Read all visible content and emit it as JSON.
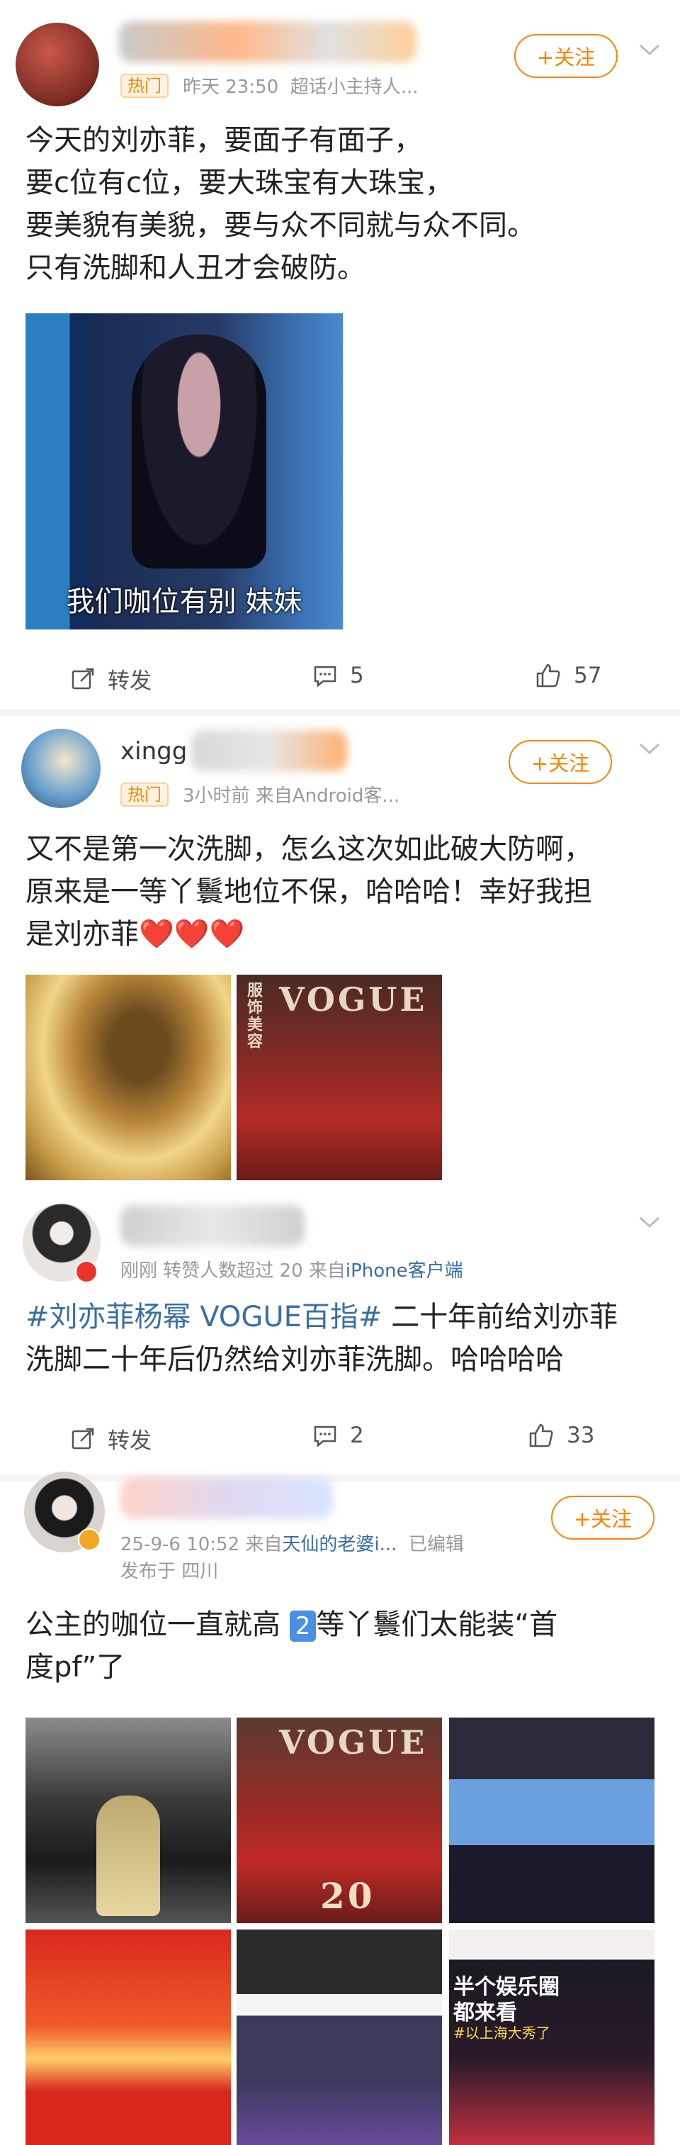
{
  "post1": {
    "hot_badge": "热门",
    "time": "昨天 23:50",
    "source": "超话小主持人...",
    "follow": "+关注",
    "lines": [
      "今天的刘亦菲，要面子有面子，",
      "要c位有c位，要大珠宝有大珠宝，",
      "要美貌有美貌，要与众不同就与众不同。",
      "只有洗脚和人丑才会破防。"
    ],
    "image_caption": "我们咖位有别 妹妹",
    "repost_label": "转发",
    "comments": "5",
    "likes": "57"
  },
  "post2": {
    "username": "xingg",
    "hot_badge": "热门",
    "meta": "3小时前  来自Android客...",
    "follow": "+关注",
    "lines": [
      "又不是第一次洗脚，怎么这次如此破大防啊，",
      "原来是一等丫鬟地位不保，哈哈哈！幸好我担",
      "是刘亦菲"
    ],
    "hearts": "❤️❤️❤️",
    "vogue_text": "VOGUE",
    "vogue_cn": "服饰美容"
  },
  "post3": {
    "meta_prefix": "刚刚  转赞人数超过 20  来自",
    "meta_link": "iPhone客户端",
    "hashtag": "#刘亦菲杨幂 VOGUE百指#",
    "text_after_tag": " 二十年前给刘亦菲",
    "line2": "洗脚二十年后仍然给刘亦菲洗脚。哈哈哈哈",
    "repost_label": "转发",
    "comments": "2",
    "likes": "33"
  },
  "post4": {
    "meta_prefix": "25-9-6 10:52  来自",
    "meta_link": "天仙的老婆i...",
    "edited": "已编辑",
    "location": "发布于 四川",
    "follow": "+关注",
    "line1_a": "公主的咖位一直就高  ",
    "line1_num": "2",
    "line1_b": "等丫鬟们太能装“首",
    "line2": "度pf”了",
    "vogue_text": "VOGUE",
    "vogue_num": "20",
    "grid_text_1": "半个娱乐圈",
    "grid_text_2": "都来看",
    "grid_text_3": "#以上海大秀了"
  },
  "colors": {
    "accent": "#ff8200",
    "link": "#3a6ea5",
    "hot_bg": "#fff1e0"
  }
}
